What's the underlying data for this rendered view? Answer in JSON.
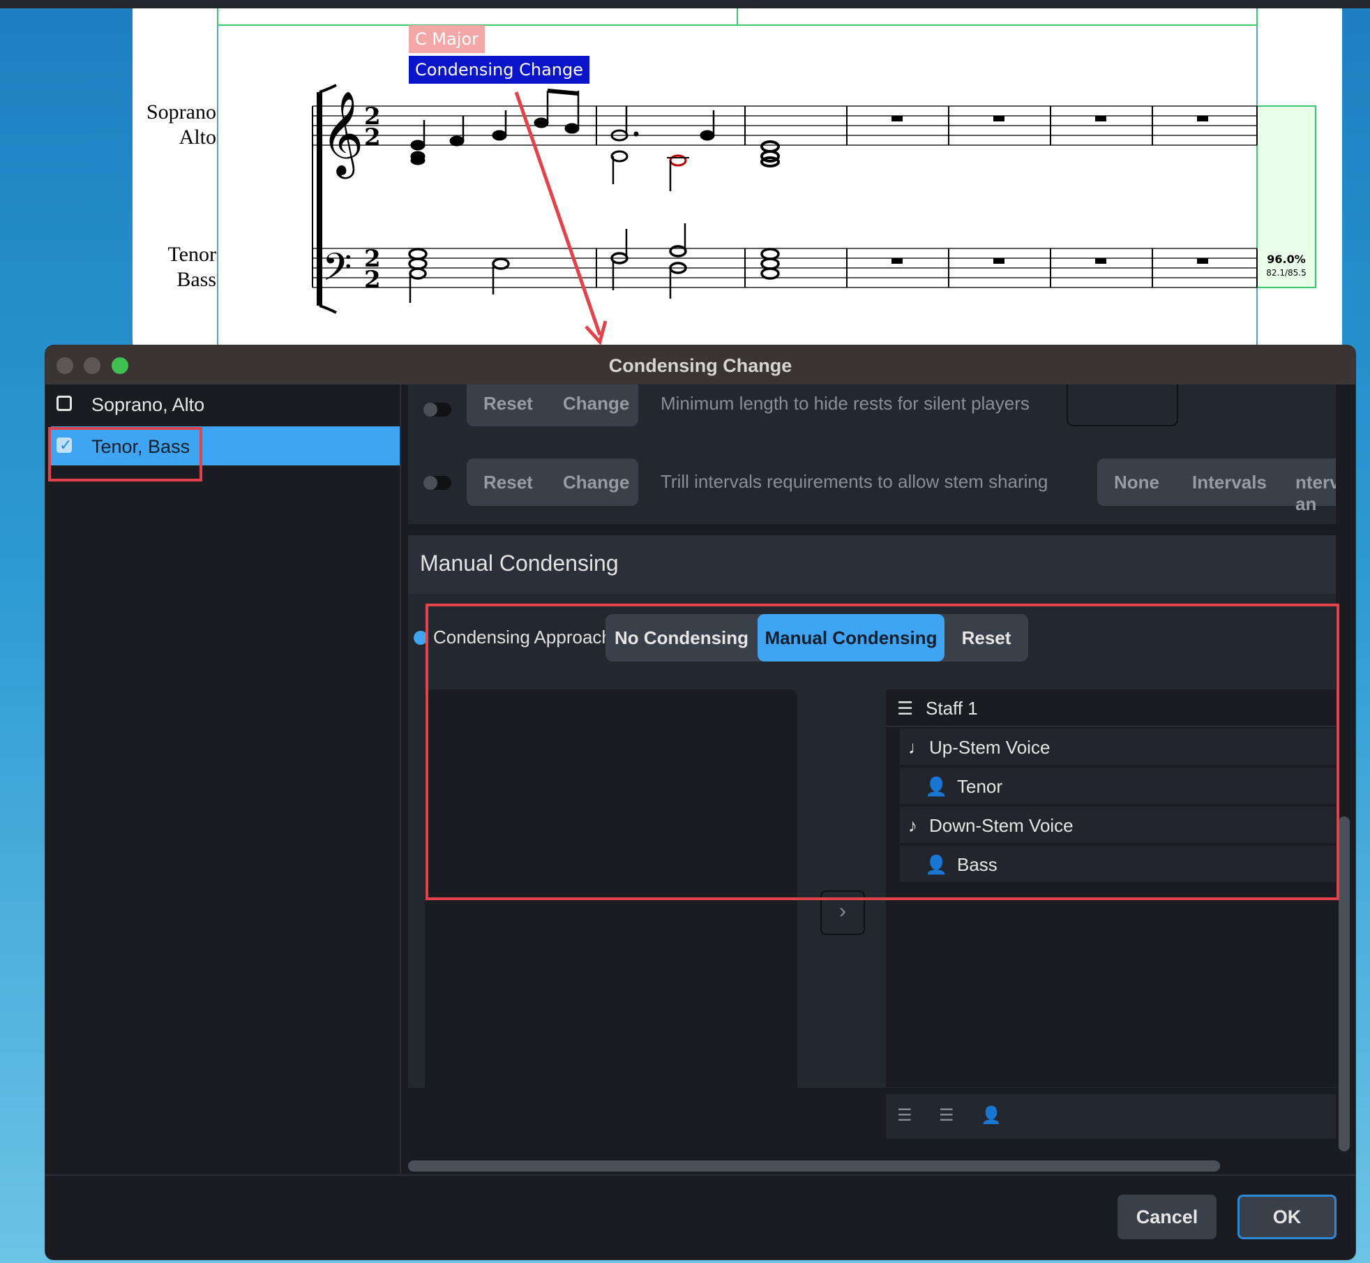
{
  "score": {
    "key_tag": "C Major",
    "condensing_tag": "Condensing Change",
    "parts": [
      {
        "line1": "Soprano",
        "line2": "Alto"
      },
      {
        "line1": "Tenor",
        "line2": "Bass"
      }
    ],
    "fit_percent": "96.0%",
    "fit_ratio": "82.1/85.5"
  },
  "dialog": {
    "title": "Condensing Change",
    "sidebar": {
      "items": [
        {
          "label": "Soprano, Alto",
          "checked": false
        },
        {
          "label": "Tenor, Bass",
          "checked": true
        }
      ]
    },
    "options": [
      {
        "reset_label": "Reset",
        "change_label": "Change",
        "label": "Minimum length to hide rests for silent players"
      },
      {
        "reset_label": "Reset",
        "change_label": "Change",
        "label": "Trill intervals requirements to allow stem sharing",
        "choices": [
          "None",
          "Intervals",
          "ntervals an"
        ]
      }
    ],
    "manual": {
      "header": "Manual Condensing",
      "approach_label": "Condensing Approach",
      "approach_options": [
        "No Condensing",
        "Manual Condensing",
        "Reset"
      ],
      "approach_selected": "Manual Condensing",
      "move_icon": "chevron-right-icon",
      "tree": {
        "staff": "Staff 1",
        "up_voice": "Up-Stem Voice",
        "up_player": "Tenor",
        "down_voice": "Down-Stem Voice",
        "down_player": "Bass"
      }
    },
    "buttons": {
      "cancel": "Cancel",
      "ok": "OK"
    }
  },
  "colors": {
    "accent": "#3fa5f2",
    "highlight": "#e2434a",
    "condensing_tag_bg": "#0a14c8",
    "key_tag_bg": "#f4a7a7"
  }
}
